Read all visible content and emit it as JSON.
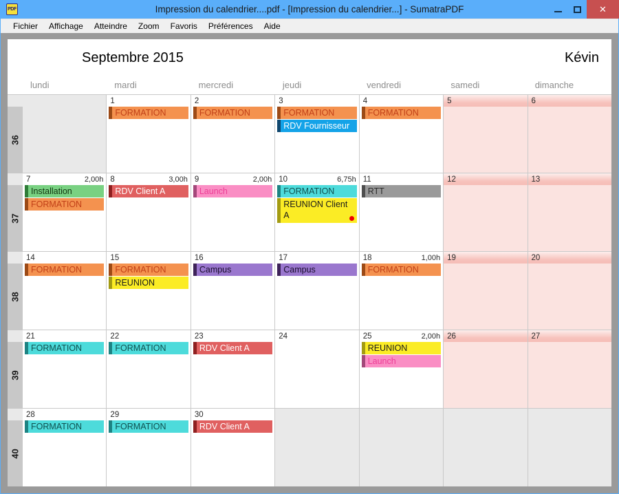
{
  "window": {
    "title": "Impression du calendrier....pdf - [Impression du calendrier...] - SumatraPDF",
    "app_icon": "PDF",
    "buttons": {
      "minimize": "minimize-icon",
      "maximize": "maximize-icon",
      "close": "✕"
    }
  },
  "menubar": {
    "items": [
      {
        "label": "Fichier"
      },
      {
        "label": "Affichage"
      },
      {
        "label": "Atteindre"
      },
      {
        "label": "Zoom"
      },
      {
        "label": "Favoris"
      },
      {
        "label": "Préférences"
      },
      {
        "label": "Aide"
      }
    ]
  },
  "calendar": {
    "title": "Septembre 2015",
    "owner": "Kévin",
    "daynames": [
      "lundi",
      "mardi",
      "mercredi",
      "jeudi",
      "vendredi",
      "samedi",
      "dimanche"
    ],
    "colors": {
      "formation_orange_bg": "#f4924f",
      "formation_orange_bar": "#9c4a16",
      "formation_orange_text": "#c13f17",
      "formation_cyan_bg": "#4ddbdb",
      "formation_cyan_bar": "#1d8383",
      "formation_cyan_text": "#0f4f4f",
      "rdv_fournisseur_bg": "#14a3e8",
      "rdv_fournisseur_bar": "#10476e",
      "rdv_fournisseur_text": "#ffffff",
      "installation_bg": "#79d182",
      "installation_bar": "#2f7d38",
      "installation_text": "#123a17",
      "rdv_client_bg": "#e06060",
      "rdv_client_bar": "#8e2020",
      "rdv_client_text": "#ffffff",
      "launch_bg": "#fa8ec4",
      "launch_bar": "#a3partial",
      "launch_text": "#e8398e",
      "reunion_bg": "#fbec25",
      "reunion_bar": "#a39b12",
      "reunion_text": "#1a1a1a",
      "rtt_bg": "#9a9a9a",
      "rtt_bar": "#4e4e4e",
      "rtt_text": "#2b2b2b",
      "campus_bg": "#9a77ce",
      "campus_bar": "#3d2258",
      "campus_text": "#1c1030",
      "weekend_bg": "#fbe3e0",
      "alert_dot": "#ee0000"
    },
    "weeks": [
      {
        "number": "36",
        "days": [
          {
            "num": "",
            "empty": true,
            "events": []
          },
          {
            "num": "1",
            "events": [
              {
                "label": "FORMATION",
                "style": "formation-orange"
              }
            ]
          },
          {
            "num": "2",
            "events": [
              {
                "label": "FORMATION",
                "style": "formation-orange"
              }
            ]
          },
          {
            "num": "3",
            "events": [
              {
                "label": "FORMATION",
                "style": "formation-orange"
              },
              {
                "label": "RDV Fournisseur",
                "style": "rdv-fournisseur"
              }
            ]
          },
          {
            "num": "4",
            "events": [
              {
                "label": "FORMATION",
                "style": "formation-orange"
              }
            ]
          },
          {
            "num": "5",
            "weekend": true,
            "events": []
          },
          {
            "num": "6",
            "weekend": true,
            "events": []
          }
        ]
      },
      {
        "number": "37",
        "days": [
          {
            "num": "7",
            "hours": "2,00h",
            "events": [
              {
                "label": "Installation",
                "style": "installation"
              },
              {
                "label": "FORMATION",
                "style": "formation-orange"
              }
            ]
          },
          {
            "num": "8",
            "hours": "3,00h",
            "events": [
              {
                "label": "RDV Client A",
                "style": "rdv-client"
              }
            ]
          },
          {
            "num": "9",
            "hours": "2,00h",
            "events": [
              {
                "label": "Launch",
                "style": "launch"
              }
            ]
          },
          {
            "num": "10",
            "hours": "6,75h",
            "events": [
              {
                "label": "FORMATION",
                "style": "formation-cyan"
              },
              {
                "label": "REUNION Client A",
                "style": "reunion",
                "dot": true,
                "tall": true
              }
            ]
          },
          {
            "num": "11",
            "events": [
              {
                "label": "RTT",
                "style": "rtt"
              }
            ]
          },
          {
            "num": "12",
            "weekend": true,
            "events": []
          },
          {
            "num": "13",
            "weekend": true,
            "events": []
          }
        ]
      },
      {
        "number": "38",
        "days": [
          {
            "num": "14",
            "events": [
              {
                "label": "FORMATION",
                "style": "formation-orange"
              }
            ]
          },
          {
            "num": "15",
            "events": [
              {
                "label": "FORMATION",
                "style": "formation-orange"
              },
              {
                "label": "REUNION",
                "style": "reunion"
              }
            ]
          },
          {
            "num": "16",
            "events": [
              {
                "label": "Campus",
                "style": "campus"
              }
            ]
          },
          {
            "num": "17",
            "events": [
              {
                "label": "Campus",
                "style": "campus"
              }
            ]
          },
          {
            "num": "18",
            "hours": "1,00h",
            "events": [
              {
                "label": "FORMATION",
                "style": "formation-orange"
              }
            ]
          },
          {
            "num": "19",
            "weekend": true,
            "events": []
          },
          {
            "num": "20",
            "weekend": true,
            "events": []
          }
        ]
      },
      {
        "number": "39",
        "days": [
          {
            "num": "21",
            "events": [
              {
                "label": "FORMATION",
                "style": "formation-cyan"
              }
            ]
          },
          {
            "num": "22",
            "events": [
              {
                "label": "FORMATION",
                "style": "formation-cyan"
              }
            ]
          },
          {
            "num": "23",
            "events": [
              {
                "label": "RDV Client A",
                "style": "rdv-client"
              }
            ]
          },
          {
            "num": "24",
            "events": []
          },
          {
            "num": "25",
            "hours": "2,00h",
            "events": [
              {
                "label": "REUNION",
                "style": "reunion"
              },
              {
                "label": "Launch",
                "style": "launch"
              }
            ]
          },
          {
            "num": "26",
            "weekend": true,
            "events": []
          },
          {
            "num": "27",
            "weekend": true,
            "events": []
          }
        ]
      },
      {
        "number": "40",
        "days": [
          {
            "num": "28",
            "events": [
              {
                "label": "FORMATION",
                "style": "formation-cyan"
              }
            ]
          },
          {
            "num": "29",
            "events": [
              {
                "label": "FORMATION",
                "style": "formation-cyan"
              }
            ]
          },
          {
            "num": "30",
            "events": [
              {
                "label": "RDV Client A",
                "style": "rdv-client"
              }
            ]
          },
          {
            "num": "",
            "empty": true,
            "events": []
          },
          {
            "num": "",
            "empty": true,
            "events": []
          },
          {
            "num": "",
            "empty": true,
            "events": []
          },
          {
            "num": "",
            "empty": true,
            "events": []
          }
        ]
      }
    ]
  }
}
